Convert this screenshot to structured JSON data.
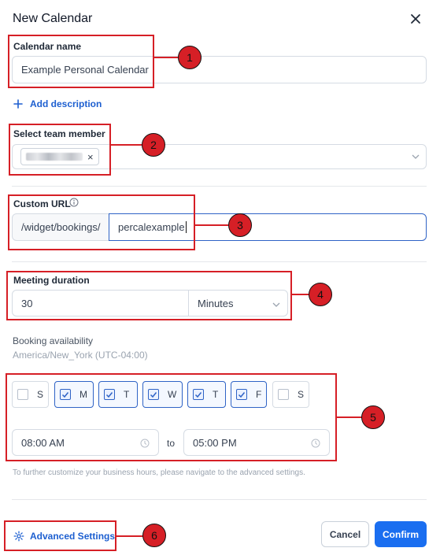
{
  "header": {
    "title": "New Calendar",
    "close_icon": "close-icon"
  },
  "calendar_name": {
    "label": "Calendar name",
    "value": "Example Personal Calendar"
  },
  "add_description": {
    "label": "Add description",
    "icon": "plus-icon"
  },
  "team_member": {
    "label": "Select team member",
    "chip_remove": "×",
    "dropdown_icon": "chevron-down-icon"
  },
  "custom_url": {
    "label": "Custom URL",
    "info_icon": "info-icon",
    "prefix": "/widget/bookings/",
    "value": "percalexample"
  },
  "meeting_duration": {
    "label": "Meeting duration",
    "value": "30",
    "unit": "Minutes"
  },
  "booking": {
    "title": "Booking availability",
    "timezone": "America/New_York (UTC-04:00)"
  },
  "days": [
    {
      "label": "S",
      "checked": false
    },
    {
      "label": "M",
      "checked": true
    },
    {
      "label": "T",
      "checked": true
    },
    {
      "label": "W",
      "checked": true
    },
    {
      "label": "T",
      "checked": true
    },
    {
      "label": "F",
      "checked": true
    },
    {
      "label": "S",
      "checked": false
    }
  ],
  "hours": {
    "start": "08:00 AM",
    "separator": "to",
    "end": "05:00 PM"
  },
  "hint": "To further customize your business hours, please navigate to the advanced settings.",
  "footer": {
    "advanced": "Advanced Settings",
    "cancel": "Cancel",
    "confirm": "Confirm"
  },
  "annotations": [
    "1",
    "2",
    "3",
    "4",
    "5",
    "6"
  ],
  "colors": {
    "annotation": "#d61f26",
    "accent": "#1a6ef0",
    "link": "#1d5fd0"
  }
}
